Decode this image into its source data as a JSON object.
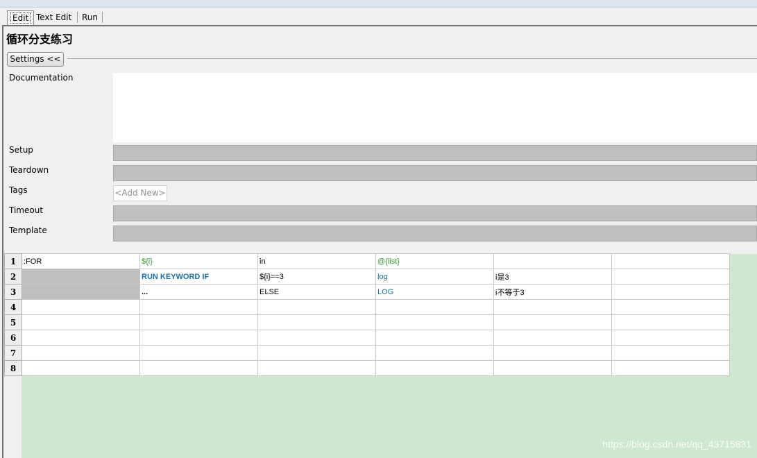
{
  "tabs": [
    {
      "label": "Edit"
    },
    {
      "label": "Text Edit"
    },
    {
      "label": "Run"
    }
  ],
  "title": "循环分支练习",
  "settings_button": "Settings <<",
  "settings": {
    "documentation_label": "Documentation",
    "setup_label": "Setup",
    "teardown_label": "Teardown",
    "tags_label": "Tags",
    "tags_placeholder": "<Add New>",
    "timeout_label": "Timeout",
    "template_label": "Template"
  },
  "grid": {
    "row_numbers": [
      "1",
      "2",
      "3",
      "4",
      "5",
      "6",
      "7",
      "8"
    ],
    "rows": [
      [
        ":FOR",
        "${i}",
        "in",
        "@{list}",
        "",
        ""
      ],
      [
        "",
        "RUN KEYWORD IF",
        "${i}==3",
        "log",
        "i是3",
        ""
      ],
      [
        "",
        "...",
        "ELSE",
        "LOG",
        "i不等于3",
        ""
      ],
      [
        "",
        "",
        "",
        "",
        "",
        ""
      ],
      [
        "",
        "",
        "",
        "",
        "",
        ""
      ],
      [
        "",
        "",
        "",
        "",
        "",
        ""
      ],
      [
        "",
        "",
        "",
        "",
        "",
        ""
      ],
      [
        "",
        "",
        "",
        "",
        "",
        ""
      ]
    ]
  },
  "watermark": "https://blog.csdn.net/qq_43715831",
  "colors": {
    "variable": "#2e9a2e",
    "keyword": "#1a6fb0",
    "empty_area": "#cde7d0",
    "readonly_field": "#c0c0c0"
  }
}
